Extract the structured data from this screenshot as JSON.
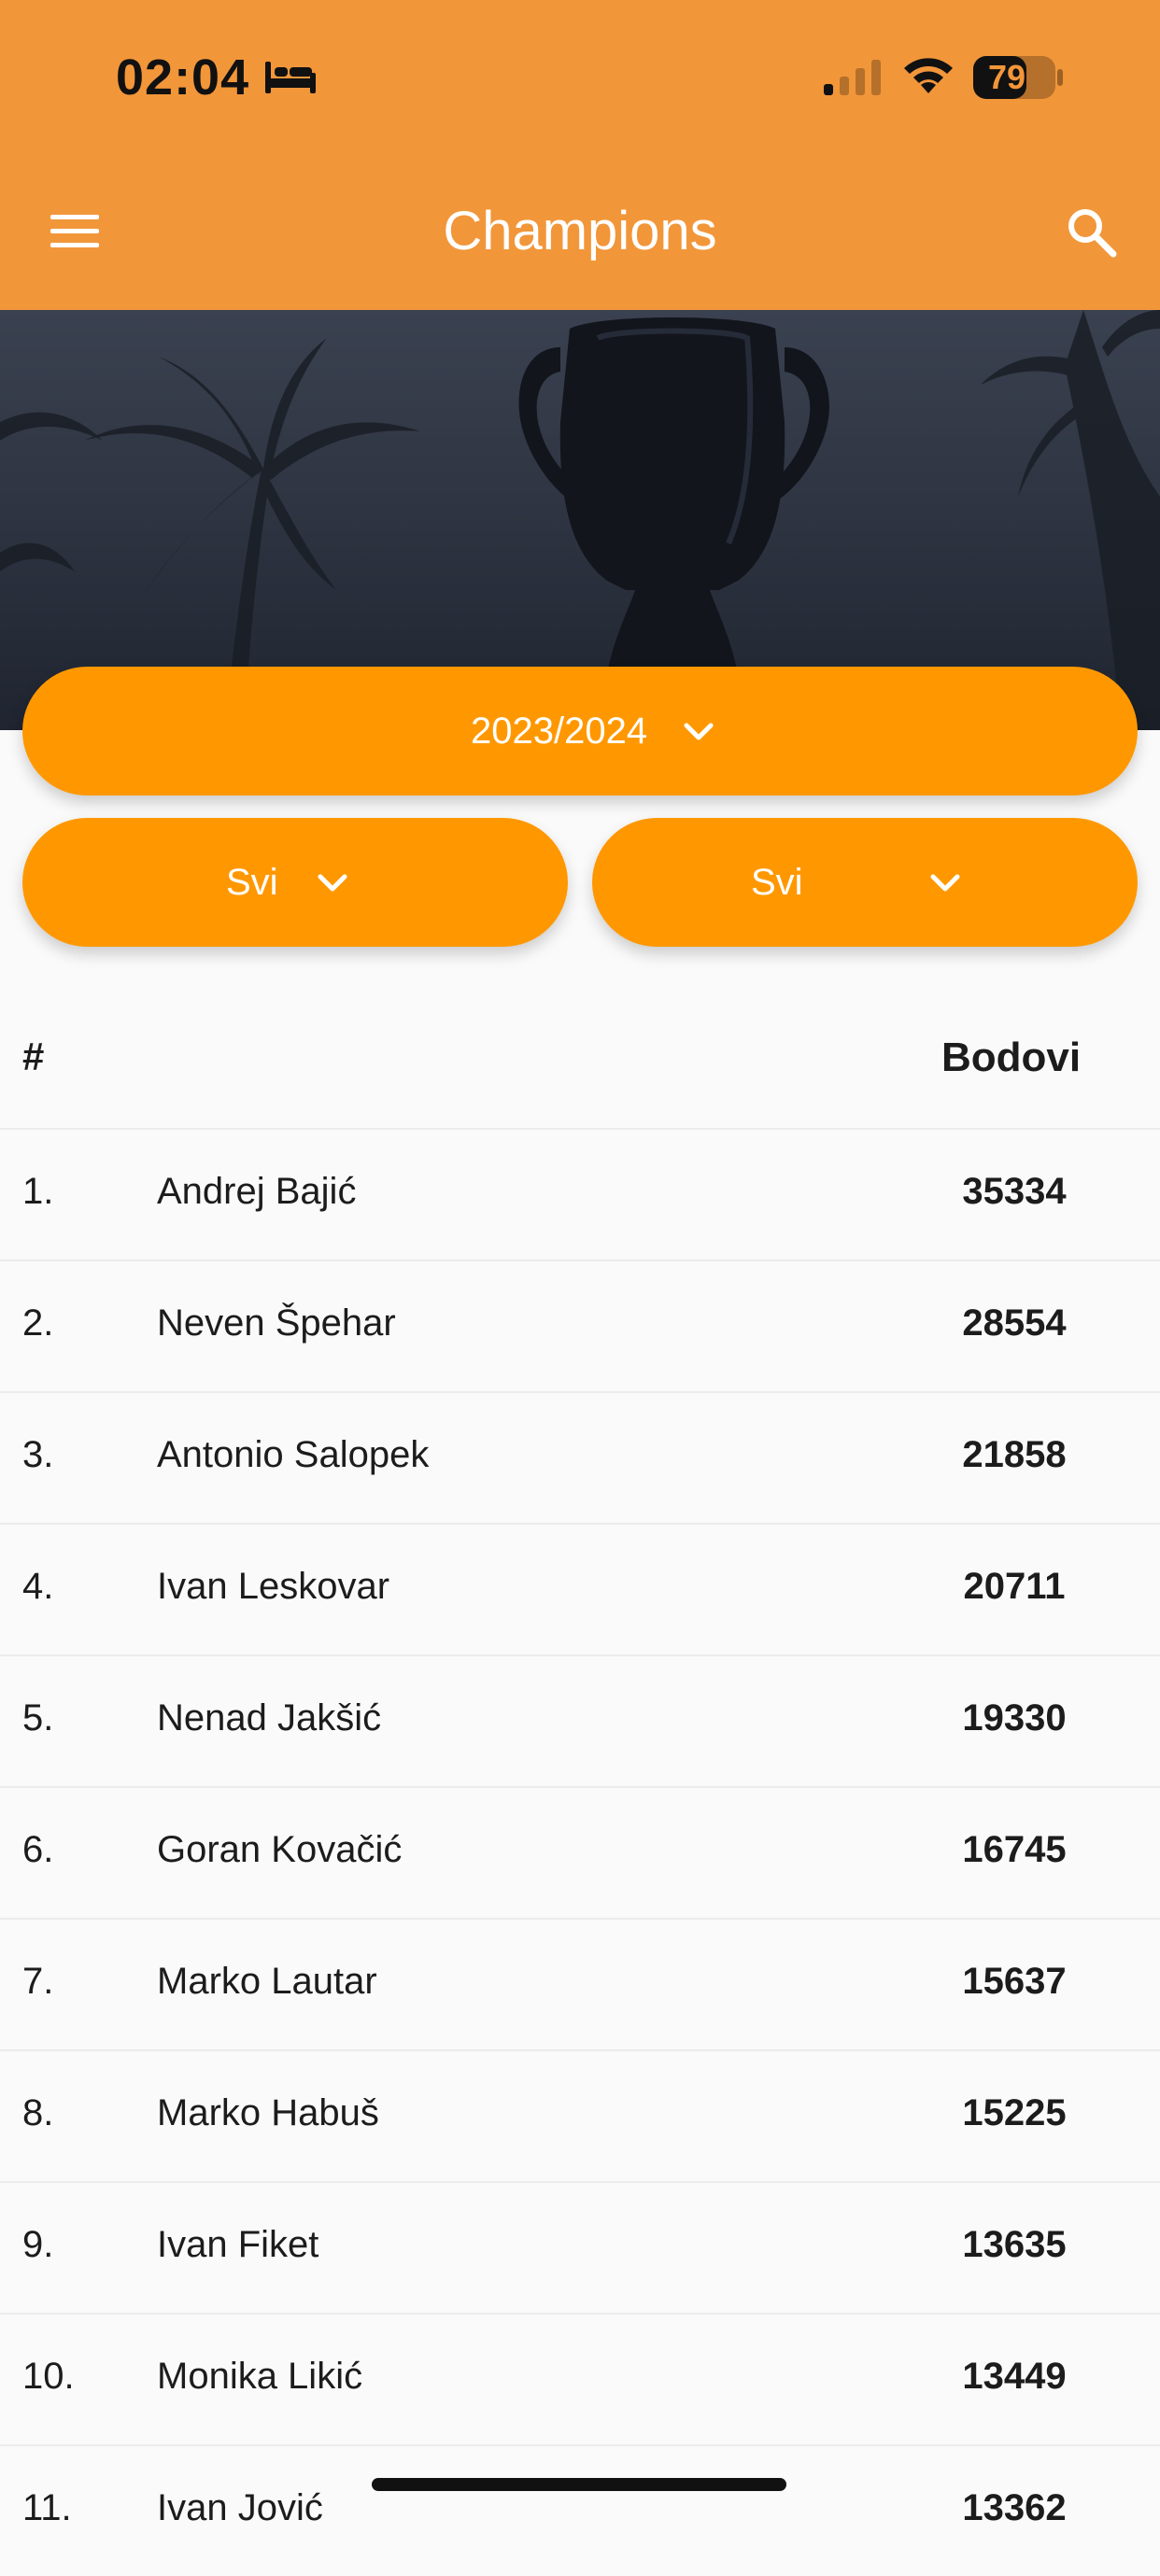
{
  "status_bar": {
    "time": "02:04",
    "battery": "79",
    "battery_level": 0.79
  },
  "app_bar": {
    "title": "Champions",
    "menu_icon": "menu-icon",
    "search_icon": "search-icon"
  },
  "filters": {
    "season": "2023/2024",
    "left": "Svi",
    "right": "Svi"
  },
  "table": {
    "headers": {
      "rank": "#",
      "points": "Bodovi"
    },
    "rows": [
      {
        "rank": "1.",
        "name": "Andrej Bajić",
        "points": "35334"
      },
      {
        "rank": "2.",
        "name": "Neven Špehar",
        "points": "28554"
      },
      {
        "rank": "3.",
        "name": "Antonio Salopek",
        "points": "21858"
      },
      {
        "rank": "4.",
        "name": "Ivan Leskovar",
        "points": "20711"
      },
      {
        "rank": "5.",
        "name": "Nenad Jakšić",
        "points": "19330"
      },
      {
        "rank": "6.",
        "name": "Goran Kovačić",
        "points": "16745"
      },
      {
        "rank": "7.",
        "name": "Marko Lautar",
        "points": "15637"
      },
      {
        "rank": "8.",
        "name": "Marko Habuš",
        "points": "15225"
      },
      {
        "rank": "9.",
        "name": "Ivan Fiket",
        "points": "13635"
      },
      {
        "rank": "10.",
        "name": "Monika Likić",
        "points": "13449"
      },
      {
        "rank": "11.",
        "name": "Ivan Jović",
        "points": "13362"
      }
    ]
  },
  "colors": {
    "app_bar": "#f2963a",
    "accent": "#ff9800"
  }
}
